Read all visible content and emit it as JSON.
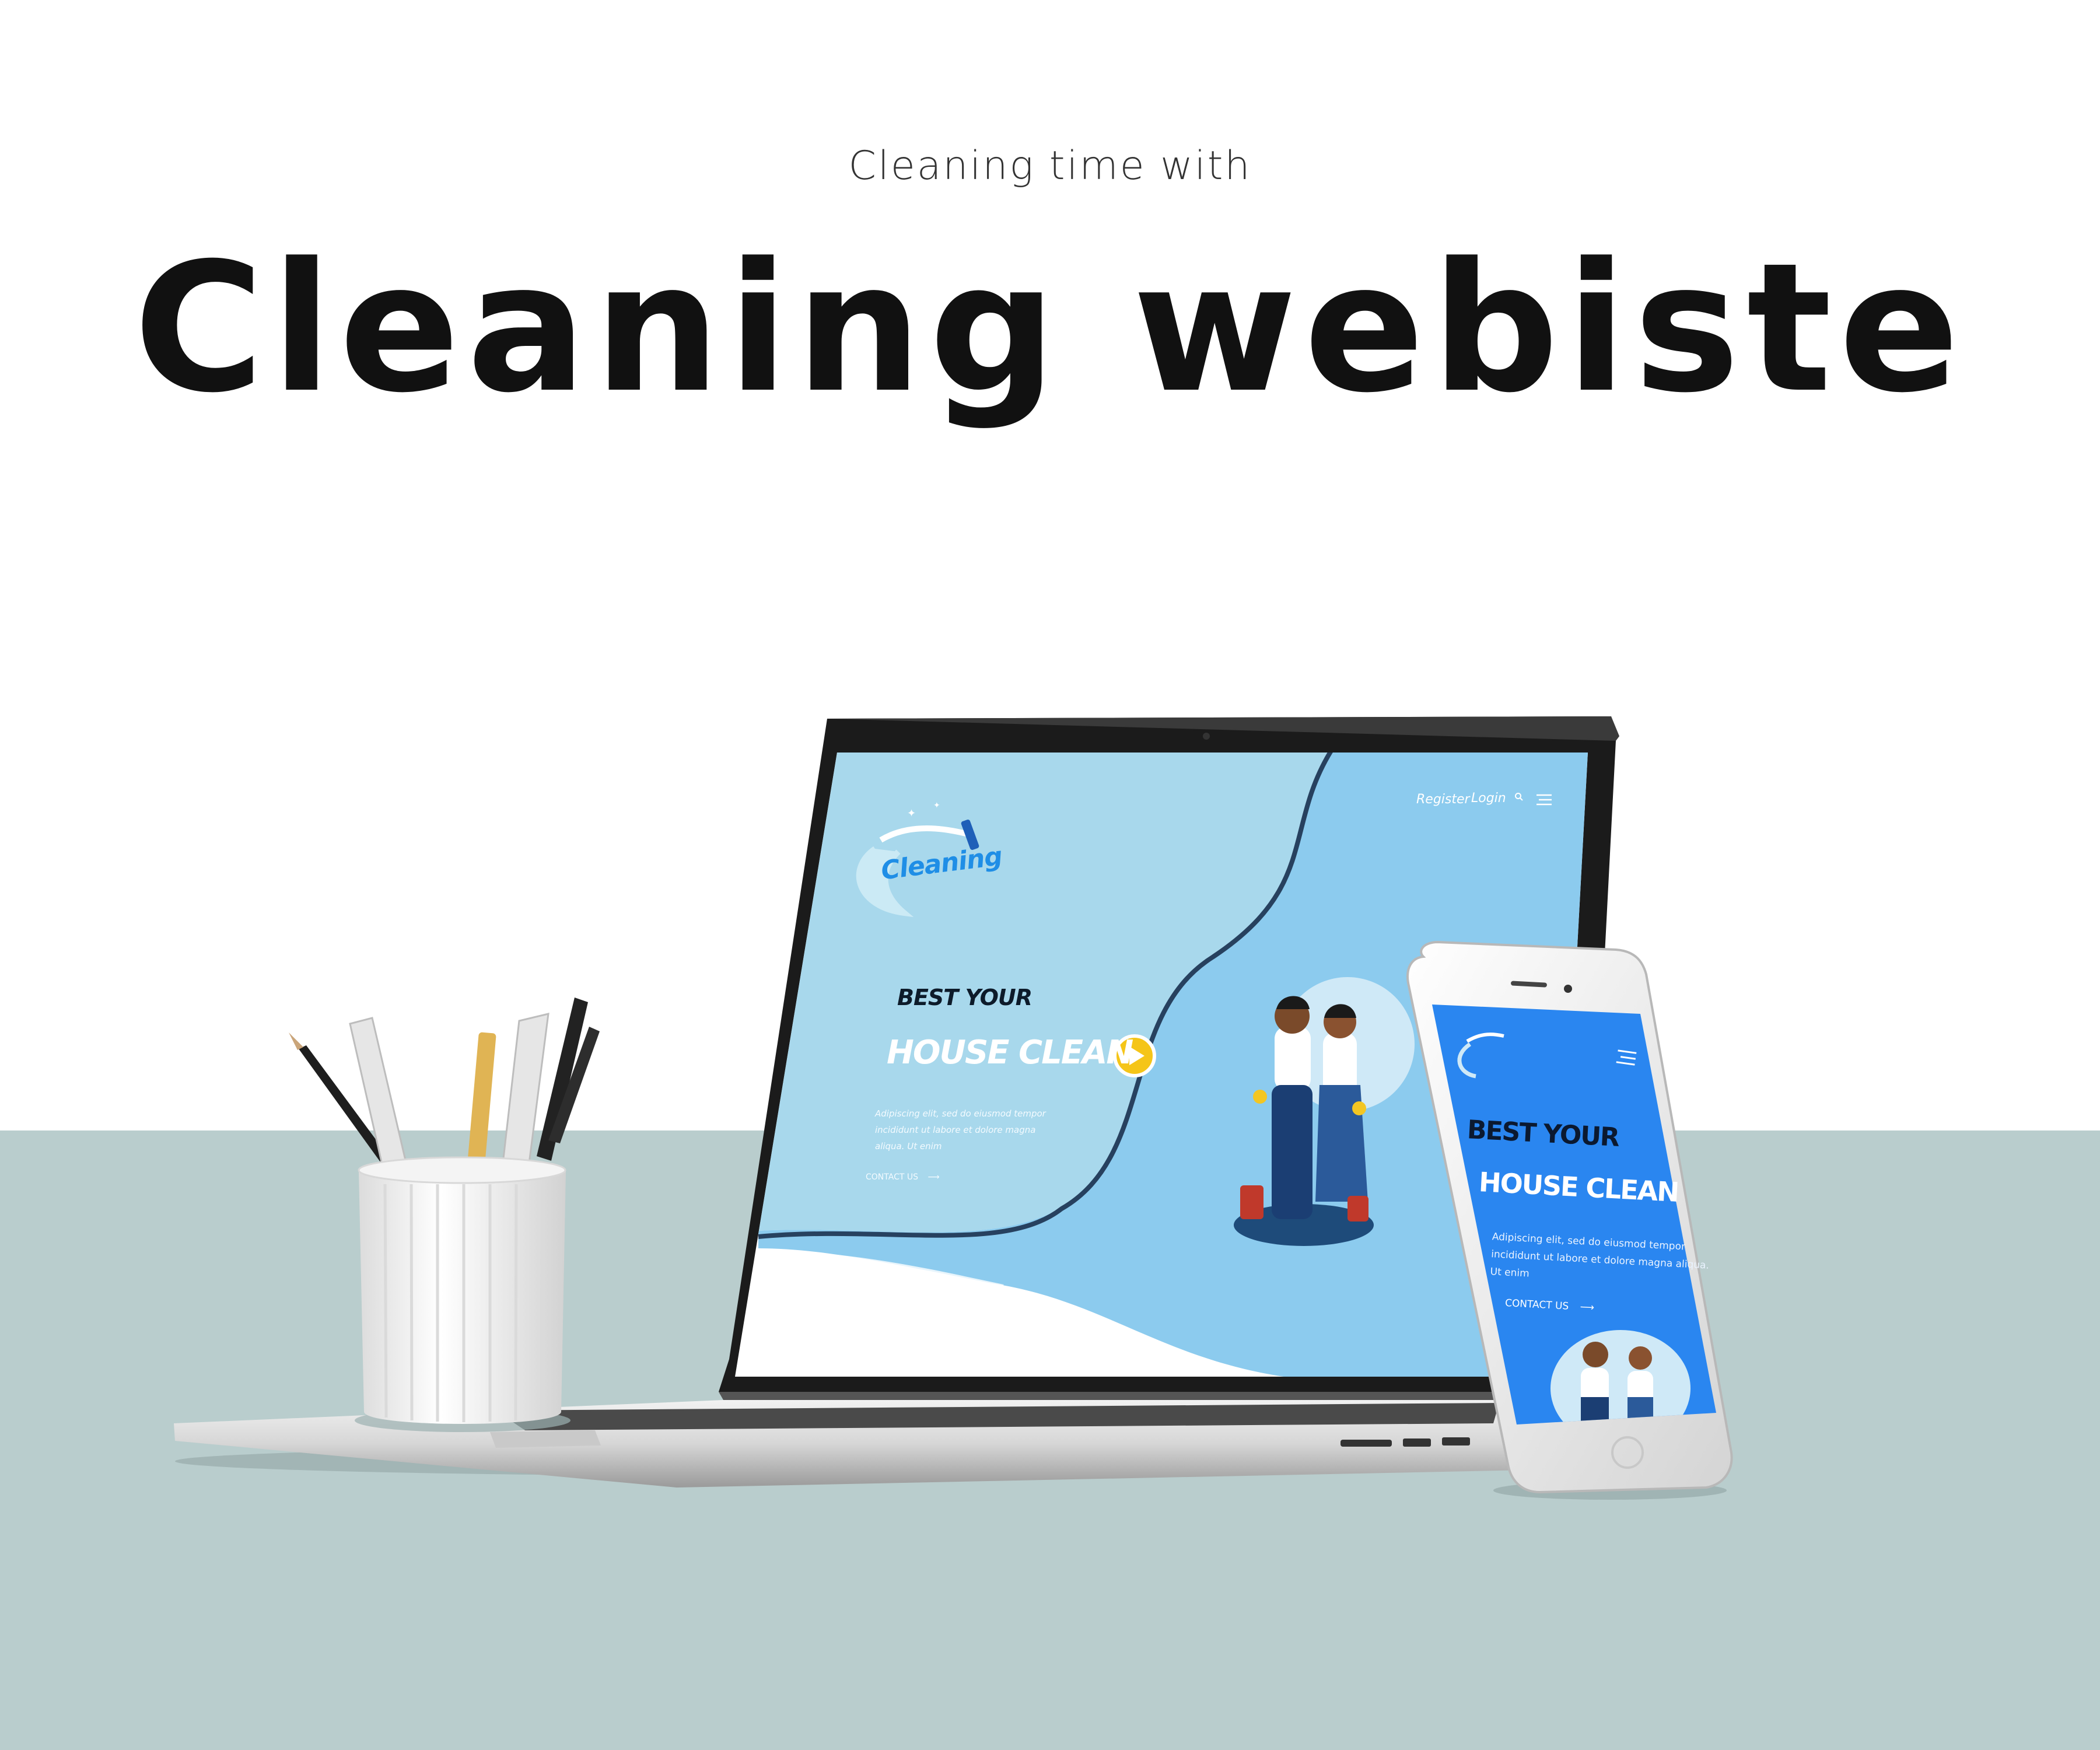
{
  "header": {
    "subtitle": "Cleaning time with",
    "title": "Cleaning webiste"
  },
  "laptop_site": {
    "logo_text": "Cleaning",
    "nav": {
      "register": "Register",
      "login": "Login",
      "search_icon": "search-icon",
      "menu_icon": "hamburger-menu-icon"
    },
    "hero": {
      "headline_1": "BEST YOUR",
      "headline_2": "HOUSE CLEAN",
      "paragraph": "Adipiscing elit, sed do eiusmod tempor incididunt ut labore et dolore magna aliqua. Ut enim",
      "cta": "CONTACT US",
      "play_icon": "play-icon"
    }
  },
  "phone_site": {
    "menu_icon": "hamburger-menu-icon",
    "hero": {
      "headline_1": "BEST YOUR",
      "headline_2": "HOUSE CLEAN",
      "paragraph": "Adipiscing elit, sed do eiusmod tempor incididunt ut labore et dolore magna aliqua. Ut enim",
      "cta": "CONTACT US"
    }
  },
  "colors": {
    "background": "#ffffff",
    "table": "#b9cdcd",
    "laptop_screen_light": "#a8d8ec",
    "laptop_screen_mid": "#8ccbee",
    "phone_screen": "#2a86f0",
    "play_button": "#f5c518"
  }
}
